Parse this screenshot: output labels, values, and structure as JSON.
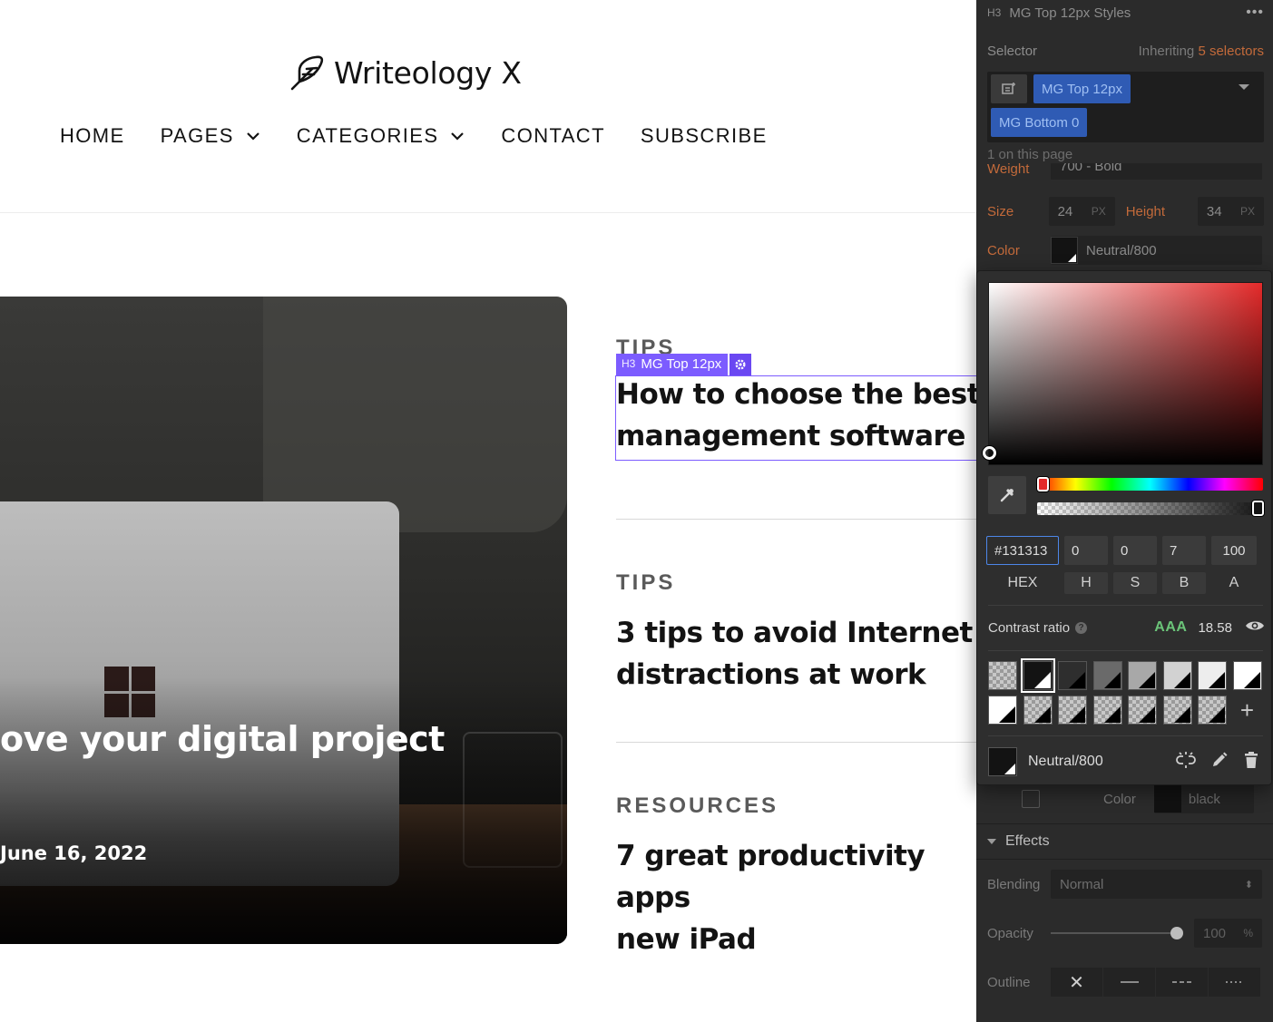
{
  "site": {
    "logo_text": "Writeology X",
    "nav": [
      {
        "label": "HOME",
        "dropdown": false
      },
      {
        "label": "PAGES",
        "dropdown": true
      },
      {
        "label": "CATEGORIES",
        "dropdown": true
      },
      {
        "label": "CONTACT",
        "dropdown": false
      },
      {
        "label": "SUBSCRIBE",
        "dropdown": false
      }
    ],
    "hero": {
      "title": "ove your digital project",
      "date": "June 16, 2022"
    },
    "posts": [
      {
        "category": "TIPS",
        "title_line1": "How to choose the best",
        "title_line2": "management software"
      },
      {
        "category": "TIPS",
        "title_line1": "3 tips to avoid Internet",
        "title_line2": "distractions at work"
      },
      {
        "category": "RESOURCES",
        "title_line1": "7 great productivity apps",
        "title_line2": "new iPad"
      }
    ],
    "selection_label": {
      "tag": "H3",
      "class_name": "MG Top 12px"
    }
  },
  "panel": {
    "header": {
      "tag": "H3",
      "title": "MG Top 12px Styles",
      "menu": "•••"
    },
    "selector_label": "Selector",
    "inheriting_text": "Inheriting",
    "inheriting_count": "5 selectors",
    "selector_chips": [
      "MG Top 12px",
      "MG Bottom 0"
    ],
    "on_page": "1 on this page",
    "weight": {
      "label": "Weight",
      "value": "700 - Bold"
    },
    "size": {
      "label": "Size",
      "value": "24",
      "unit": "PX"
    },
    "height": {
      "label": "Height",
      "value": "34",
      "unit": "PX"
    },
    "color": {
      "label": "Color",
      "value": "Neutral/800"
    }
  },
  "picker": {
    "hex": "#131313",
    "h": "0",
    "s": "0",
    "b": "7",
    "a": "100",
    "labels": {
      "hex": "HEX",
      "h": "H",
      "s": "S",
      "b": "B",
      "a": "A"
    },
    "contrast_label": "Contrast ratio",
    "contrast_grade": "AAA",
    "contrast_value": "18.58",
    "selected_swatch_name": "Neutral/800",
    "colors": {
      "sb_hue": "#e42a2a",
      "selected": "#131313",
      "accent_green": "#6bc479",
      "focus_blue": "#4d86e8"
    }
  },
  "lower": {
    "shadow_color_label": "Color",
    "shadow_color_value": "black",
    "effects_title": "Effects",
    "blending_label": "Blending",
    "blending_value": "Normal",
    "opacity_label": "Opacity",
    "opacity_value": "100",
    "opacity_unit": "%",
    "outline_label": "Outline"
  }
}
